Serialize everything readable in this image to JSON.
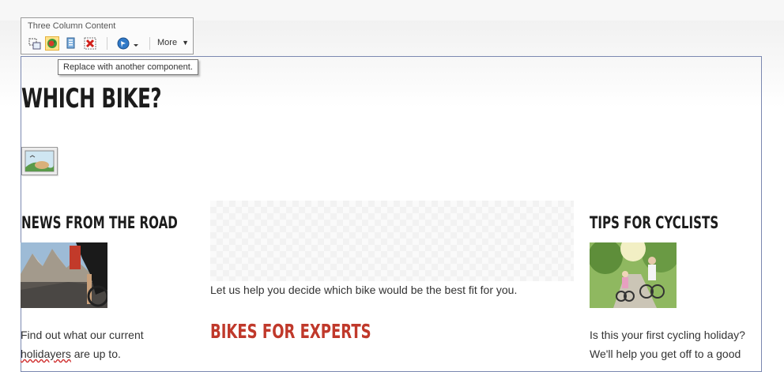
{
  "toolbar": {
    "title": "Three Column Content",
    "more_label": "More",
    "buttons": [
      "select-parent-icon",
      "replace-component-icon",
      "properties-icon",
      "delete-icon",
      "navigate-icon"
    ]
  },
  "tooltip": {
    "text": "Replace with another component."
  },
  "page": {
    "title": "WHICH BIKE?"
  },
  "columns": {
    "left": {
      "heading": "NEWS FROM THE ROAD",
      "text_line1": "Find out what our current",
      "text_line2_word": "holidayers",
      "text_line2_rest": " are up to."
    },
    "center": {
      "intro": "Let us help you decide which bike would be the best fit for you.",
      "heading": "BIKES FOR EXPERTS"
    },
    "right": {
      "heading": "TIPS FOR CYCLISTS",
      "text_line1": "Is this your first cycling holiday?",
      "text_line2": "We'll help you get off to a good"
    }
  },
  "colors": {
    "accent_red": "#c0392b",
    "frame_border": "#7b88b0"
  }
}
